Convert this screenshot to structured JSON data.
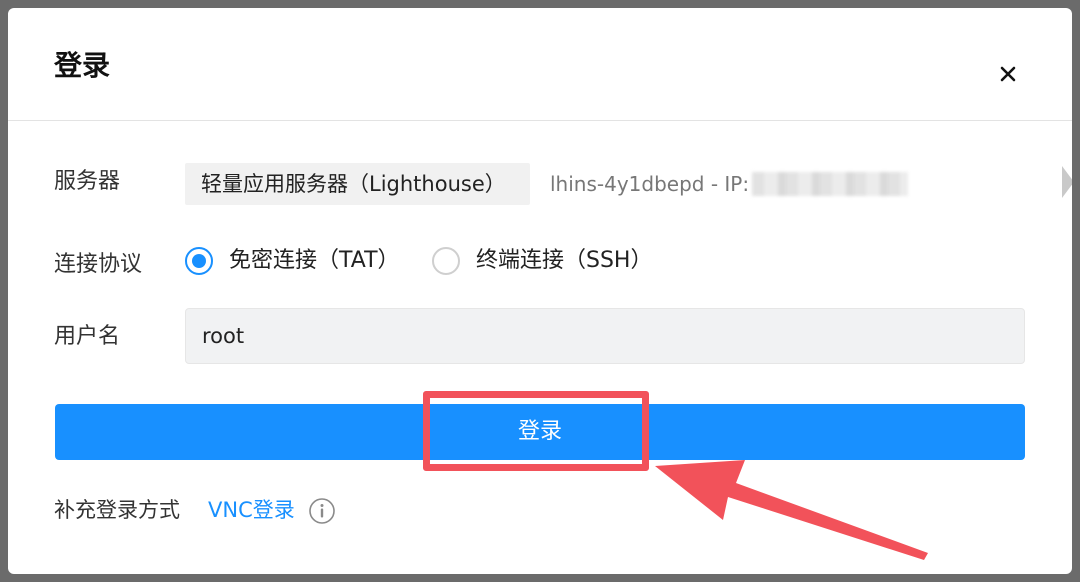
{
  "dialog": {
    "title": "登录",
    "close_label": "×"
  },
  "server": {
    "label": "服务器",
    "type": "轻量应用服务器（Lighthouse）",
    "instance_id": "lhins-4y1dbepd - IP:"
  },
  "protocol": {
    "label": "连接协议",
    "options": [
      {
        "label": "免密连接（TAT）",
        "checked": true
      },
      {
        "label": "终端连接（SSH）",
        "checked": false
      }
    ]
  },
  "username": {
    "label": "用户名",
    "value": "root"
  },
  "login_button": {
    "label": "登录"
  },
  "supplement": {
    "label": "补充登录方式",
    "vnc_link": "VNC登录"
  },
  "colors": {
    "primary": "#1890ff",
    "annotation": "#f2525a"
  },
  "icons": {
    "close": "close-icon",
    "info": "info-icon",
    "scroll": "chevron-right-icon"
  }
}
